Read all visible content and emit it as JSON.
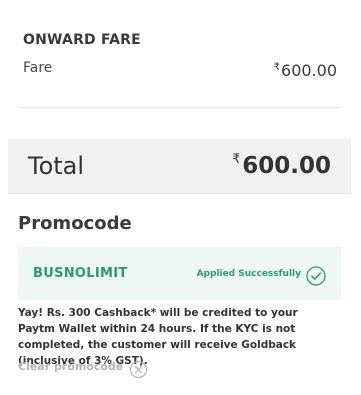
{
  "fare": {
    "heading": "ONWARD FARE",
    "label": "Fare",
    "currency_symbol": "₹",
    "amount": "600.00"
  },
  "total": {
    "label": "Total",
    "currency_symbol": "₹",
    "amount": "600.00"
  },
  "promo": {
    "heading": "Promocode",
    "code": "BUSNOLIMIT",
    "status": "Applied Successfully",
    "status_icon": "check-circle-icon",
    "message": "Yay! Rs. 300 Cashback* will be credited to your Paytm Wallet within 24 hours. If the KYC is not completed, the customer will receive Goldback (inclusive of 3% GST).",
    "clear_label": "Clear promocode",
    "clear_icon": "close-circle-icon"
  },
  "colors": {
    "accent_green": "#2a9d6f",
    "promo_bg": "#eef7f4",
    "total_bg": "#f1f1f1",
    "muted_text": "#b3b3b3"
  }
}
